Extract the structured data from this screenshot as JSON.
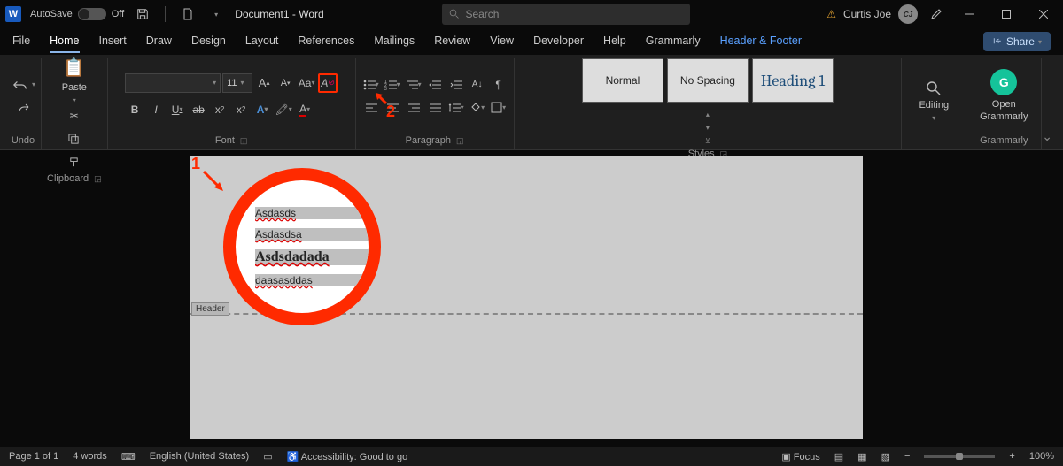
{
  "title_bar": {
    "app_initial": "W",
    "autosave_label": "AutoSave",
    "autosave_state": "Off",
    "doc_title": "Document1 - Word",
    "search_placeholder": "Search",
    "user_name": "Curtis Joe"
  },
  "tabs": {
    "file": "File",
    "home": "Home",
    "insert": "Insert",
    "draw": "Draw",
    "design": "Design",
    "layout": "Layout",
    "references": "References",
    "mailings": "Mailings",
    "review": "Review",
    "view": "View",
    "developer": "Developer",
    "help": "Help",
    "grammarly": "Grammarly",
    "contextual": "Header & Footer",
    "share": "Share"
  },
  "ribbon": {
    "undo_label": "Undo",
    "clipboard_label": "Clipboard",
    "paste_label": "Paste",
    "font_label": "Font",
    "font_size": "11",
    "paragraph_label": "Paragraph",
    "styles_label": "Styles",
    "style_normal": "Normal",
    "style_nospace": "No Spacing",
    "style_heading1": "Heading 1",
    "editing_label": "Editing",
    "grammarly_label": "Grammarly",
    "grammarly_btn": "Open Grammarly"
  },
  "document": {
    "line1": "Asdasds",
    "line2": "Asdasdsa",
    "line3": "Asdsdadada",
    "line4": "daasasddas",
    "header_chip": "Header"
  },
  "annotations": {
    "n1": "1",
    "n2": "2"
  },
  "status": {
    "page": "Page 1 of 1",
    "words": "4 words",
    "lang": "English (United States)",
    "accessibility": "Accessibility: Good to go",
    "focus": "Focus",
    "zoom": "100%"
  }
}
